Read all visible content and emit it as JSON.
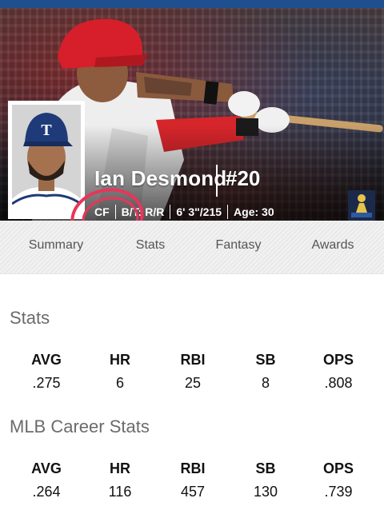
{
  "player": {
    "name": "Ian Desmond",
    "number": "#20",
    "position": "CF",
    "bats_throws": "B/T: R/R",
    "height_weight": "6' 3\"/215",
    "age": "Age: 30"
  },
  "tabs": [
    {
      "label": "Summary"
    },
    {
      "label": "Stats"
    },
    {
      "label": "Fantasy"
    },
    {
      "label": "Awards"
    }
  ],
  "stats": {
    "title": "Stats",
    "columns": [
      {
        "label": "AVG",
        "value": ".275"
      },
      {
        "label": "HR",
        "value": "6"
      },
      {
        "label": "RBI",
        "value": "25"
      },
      {
        "label": "SB",
        "value": "8"
      },
      {
        "label": "OPS",
        "value": ".808"
      }
    ]
  },
  "career": {
    "title": "MLB Career Stats",
    "columns": [
      {
        "label": "AVG",
        "value": ".264"
      },
      {
        "label": "HR",
        "value": "116"
      },
      {
        "label": "RBI",
        "value": "457"
      },
      {
        "label": "SB",
        "value": "130"
      },
      {
        "label": "OPS",
        "value": ".739"
      }
    ]
  },
  "colors": {
    "topbar": "#1f4f8f",
    "jersey_red": "#d6262b",
    "annotation": "#e8355a"
  }
}
